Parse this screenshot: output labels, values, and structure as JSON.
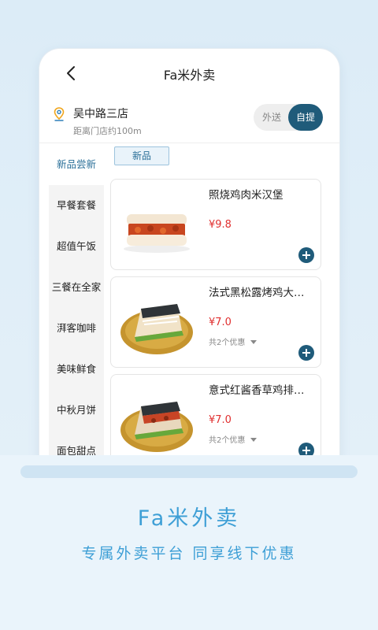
{
  "app": {
    "title": "Fa米外卖"
  },
  "store": {
    "name": "吴中路三店",
    "distance": "距离门店约100m"
  },
  "mode": {
    "delivery": "外送",
    "pickup": "自提"
  },
  "categories": [
    {
      "label": "新品尝新",
      "active": true
    },
    {
      "label": "早餐套餐"
    },
    {
      "label": "超值午饭"
    },
    {
      "label": "三餐在全家"
    },
    {
      "label": "湃客咖啡"
    },
    {
      "label": "美味鲜食"
    },
    {
      "label": "中秋月饼"
    },
    {
      "label": "面包甜点"
    }
  ],
  "section": {
    "chip": "新品"
  },
  "products": [
    {
      "name": "照烧鸡肉米汉堡",
      "price": "¥9.8",
      "promo": ""
    },
    {
      "name": "法式黑松露烤鸡大米汉堡",
      "price": "¥7.0",
      "promo": "共2个优惠"
    },
    {
      "name": "意式红酱香草鸡排米汉堡",
      "price": "¥7.0",
      "promo": "共2个优惠"
    }
  ],
  "banner": {
    "headline": "Fa米外卖",
    "tagline": "专属外卖平台 同享线下优惠"
  },
  "colors": {
    "accent": "#1f5b7a",
    "price": "#e02f2f",
    "brand": "#3e9fd6"
  },
  "icons": {
    "back": "chevron-left-icon",
    "location": "location-pin-icon",
    "add": "plus-icon",
    "promo": "caret-down-icon"
  }
}
